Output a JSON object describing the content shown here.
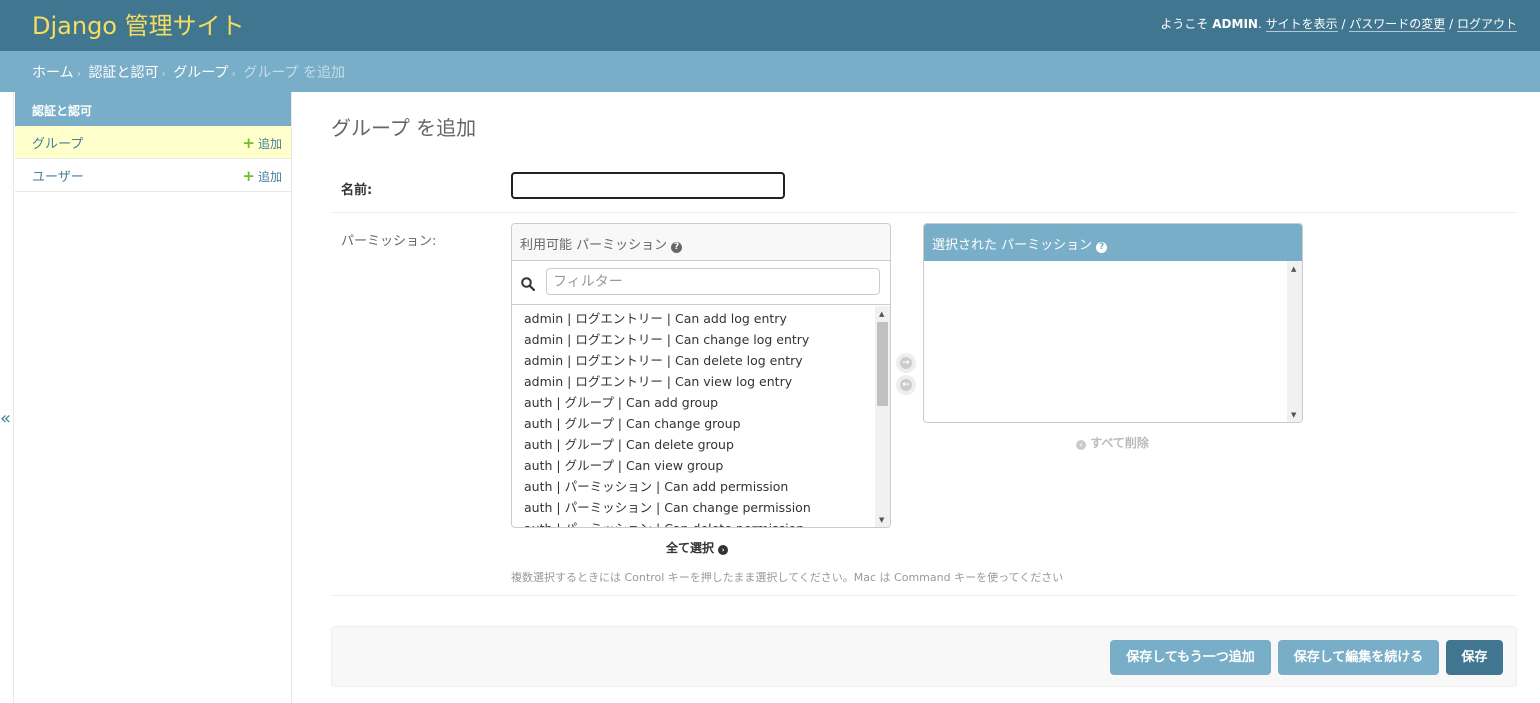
{
  "header": {
    "site_name": "Django 管理サイト",
    "welcome": "ようこそ",
    "username": "ADMIN",
    "view_site": "サイトを表示",
    "change_password": "パスワードの変更",
    "logout": "ログアウト"
  },
  "breadcrumbs": [
    "ホーム",
    "認証と認可",
    "グループ",
    "グループ を追加"
  ],
  "sidebar": {
    "toggle": "«",
    "module": "認証と認可",
    "items": [
      {
        "label": "グループ",
        "add": "追加"
      },
      {
        "label": "ユーザー",
        "add": "追加"
      }
    ]
  },
  "page": {
    "title": "グループ を追加",
    "name_label": "名前:",
    "name_value": "",
    "permissions_label": "パーミッション:"
  },
  "selector": {
    "available_title": "利用可能 パーミッション",
    "filter_placeholder": "フィルター",
    "options": [
      "admin | ログエントリー | Can add log entry",
      "admin | ログエントリー | Can change log entry",
      "admin | ログエントリー | Can delete log entry",
      "admin | ログエントリー | Can view log entry",
      "auth | グループ | Can add group",
      "auth | グループ | Can change group",
      "auth | グループ | Can delete group",
      "auth | グループ | Can view group",
      "auth | パーミッション | Can add permission",
      "auth | パーミッション | Can change permission",
      "auth | パーミッション | Can delete permission"
    ],
    "chosen_title": "選択された パーミッション",
    "choose_all": "全て選択",
    "clear_all": "すべて削除",
    "help_text": "複数選択するときには Control キーを押したまま選択してください。Mac は Command キーを使ってください"
  },
  "buttons": {
    "save_add_another": "保存してもう一つ追加",
    "save_continue": "保存して編集を続ける",
    "save": "保存"
  },
  "colors": {
    "header_bg": "#417690",
    "branding": "#f5dd5d",
    "breadcrumbs_bg": "#79aec8",
    "current_row": "#ffffcc",
    "add_plus": "#70bf2b"
  }
}
